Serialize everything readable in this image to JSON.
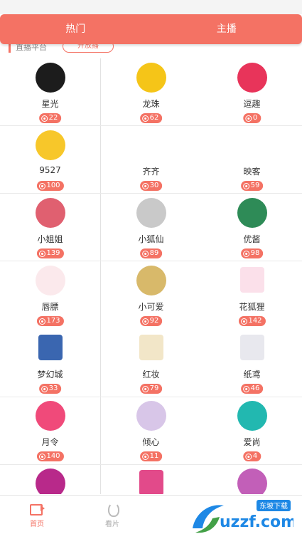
{
  "tabs": [
    {
      "label": "热门",
      "active": true
    },
    {
      "label": "主播",
      "active": false
    }
  ],
  "peek_header": {
    "text": "直播平台",
    "button": "开放播"
  },
  "platforms": [
    {
      "name": "星光",
      "count": "22",
      "icon": "gold-swirl-logo",
      "color": "#1c1c1c"
    },
    {
      "name": "龙珠",
      "count": "62",
      "icon": "green-dragon-logo",
      "color": "#f5c518"
    },
    {
      "name": "逗趣",
      "count": "0",
      "icon": "white-rabbit-logo",
      "color": "#e8345a"
    },
    {
      "name": "9527",
      "count": "100",
      "icon": "yellow-face-logo",
      "color": "#f7c72a"
    },
    {
      "name": "齐齐",
      "count": "30",
      "icon": "qiqi-live-logo",
      "color": "#ffffff"
    },
    {
      "name": "映客",
      "count": "59",
      "icon": "inke-logo",
      "color": "#ffffff"
    },
    {
      "name": "小姐姐",
      "count": "139",
      "icon": "anime-girl-logo",
      "color": "#e06070"
    },
    {
      "name": "小狐仙",
      "count": "89",
      "icon": "portrait-girl-logo",
      "color": "#c9c9c9"
    },
    {
      "name": "优酱",
      "count": "98",
      "icon": "green-ring-girl-logo",
      "color": "#2e8b57"
    },
    {
      "name": "唇膘",
      "count": "173",
      "icon": "pink-bow-logo",
      "color": "#fbe9ec"
    },
    {
      "name": "小可爱",
      "count": "92",
      "icon": "gold-portrait-logo",
      "color": "#d8b96a"
    },
    {
      "name": "花狐狸",
      "count": "142",
      "icon": "pink-fox-logo",
      "color": "#fbe0ea"
    },
    {
      "name": "梦幻城",
      "count": "33",
      "icon": "blue-castle-logo",
      "color": "#3a66b0"
    },
    {
      "name": "红妆",
      "count": "79",
      "icon": "red-rose-logo",
      "color": "#f2e6c8"
    },
    {
      "name": "纸鸢",
      "count": "46",
      "icon": "white-figure-logo",
      "color": "#e8e8ee"
    },
    {
      "name": "月令",
      "count": "140",
      "icon": "pink-camera-logo",
      "color": "#f04a7a"
    },
    {
      "name": "倾心",
      "count": "11",
      "icon": "pastel-couple-logo",
      "color": "#d8c6e8"
    },
    {
      "name": "爱尚",
      "count": "4",
      "icon": "teal-lens-logo",
      "color": "#22b8b0"
    },
    {
      "name": "",
      "count": "",
      "icon": "magenta-silhouette-logo",
      "color": "#b8298a"
    },
    {
      "name": "",
      "count": "",
      "icon": "pink-dancer-logo",
      "color": "#e24a8a"
    },
    {
      "name": "",
      "count": "",
      "icon": "purple-woman-logo",
      "color": "#c25fb8"
    }
  ],
  "bottom_nav": [
    {
      "label": "首页",
      "icon": "video-camera-icon",
      "active": true
    },
    {
      "label": "看片",
      "icon": "flame-icon",
      "active": false
    }
  ],
  "watermark": {
    "text": "uzzf.com",
    "badge": "东坡下载"
  },
  "accent_color": "#f47264"
}
